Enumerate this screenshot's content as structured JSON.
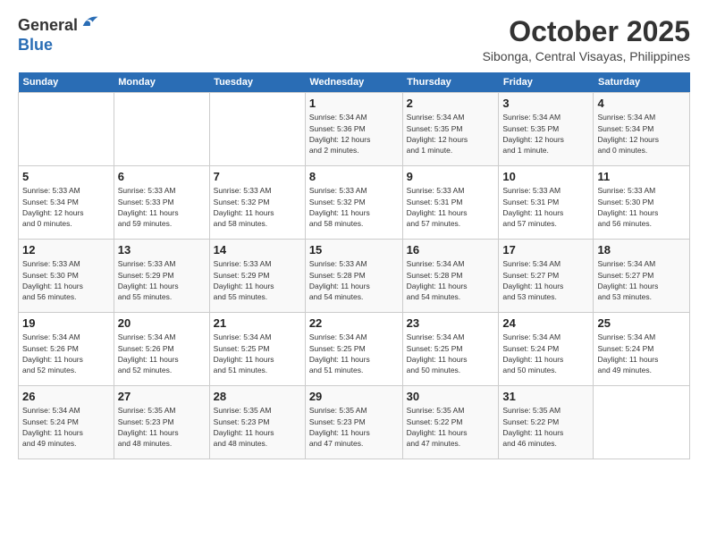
{
  "logo": {
    "general": "General",
    "blue": "Blue"
  },
  "header": {
    "month": "October 2025",
    "location": "Sibonga, Central Visayas, Philippines"
  },
  "days_of_week": [
    "Sunday",
    "Monday",
    "Tuesday",
    "Wednesday",
    "Thursday",
    "Friday",
    "Saturday"
  ],
  "weeks": [
    [
      {
        "day": "",
        "info": ""
      },
      {
        "day": "",
        "info": ""
      },
      {
        "day": "",
        "info": ""
      },
      {
        "day": "1",
        "info": "Sunrise: 5:34 AM\nSunset: 5:36 PM\nDaylight: 12 hours\nand 2 minutes."
      },
      {
        "day": "2",
        "info": "Sunrise: 5:34 AM\nSunset: 5:35 PM\nDaylight: 12 hours\nand 1 minute."
      },
      {
        "day": "3",
        "info": "Sunrise: 5:34 AM\nSunset: 5:35 PM\nDaylight: 12 hours\nand 1 minute."
      },
      {
        "day": "4",
        "info": "Sunrise: 5:34 AM\nSunset: 5:34 PM\nDaylight: 12 hours\nand 0 minutes."
      }
    ],
    [
      {
        "day": "5",
        "info": "Sunrise: 5:33 AM\nSunset: 5:34 PM\nDaylight: 12 hours\nand 0 minutes."
      },
      {
        "day": "6",
        "info": "Sunrise: 5:33 AM\nSunset: 5:33 PM\nDaylight: 11 hours\nand 59 minutes."
      },
      {
        "day": "7",
        "info": "Sunrise: 5:33 AM\nSunset: 5:32 PM\nDaylight: 11 hours\nand 58 minutes."
      },
      {
        "day": "8",
        "info": "Sunrise: 5:33 AM\nSunset: 5:32 PM\nDaylight: 11 hours\nand 58 minutes."
      },
      {
        "day": "9",
        "info": "Sunrise: 5:33 AM\nSunset: 5:31 PM\nDaylight: 11 hours\nand 57 minutes."
      },
      {
        "day": "10",
        "info": "Sunrise: 5:33 AM\nSunset: 5:31 PM\nDaylight: 11 hours\nand 57 minutes."
      },
      {
        "day": "11",
        "info": "Sunrise: 5:33 AM\nSunset: 5:30 PM\nDaylight: 11 hours\nand 56 minutes."
      }
    ],
    [
      {
        "day": "12",
        "info": "Sunrise: 5:33 AM\nSunset: 5:30 PM\nDaylight: 11 hours\nand 56 minutes."
      },
      {
        "day": "13",
        "info": "Sunrise: 5:33 AM\nSunset: 5:29 PM\nDaylight: 11 hours\nand 55 minutes."
      },
      {
        "day": "14",
        "info": "Sunrise: 5:33 AM\nSunset: 5:29 PM\nDaylight: 11 hours\nand 55 minutes."
      },
      {
        "day": "15",
        "info": "Sunrise: 5:33 AM\nSunset: 5:28 PM\nDaylight: 11 hours\nand 54 minutes."
      },
      {
        "day": "16",
        "info": "Sunrise: 5:34 AM\nSunset: 5:28 PM\nDaylight: 11 hours\nand 54 minutes."
      },
      {
        "day": "17",
        "info": "Sunrise: 5:34 AM\nSunset: 5:27 PM\nDaylight: 11 hours\nand 53 minutes."
      },
      {
        "day": "18",
        "info": "Sunrise: 5:34 AM\nSunset: 5:27 PM\nDaylight: 11 hours\nand 53 minutes."
      }
    ],
    [
      {
        "day": "19",
        "info": "Sunrise: 5:34 AM\nSunset: 5:26 PM\nDaylight: 11 hours\nand 52 minutes."
      },
      {
        "day": "20",
        "info": "Sunrise: 5:34 AM\nSunset: 5:26 PM\nDaylight: 11 hours\nand 52 minutes."
      },
      {
        "day": "21",
        "info": "Sunrise: 5:34 AM\nSunset: 5:25 PM\nDaylight: 11 hours\nand 51 minutes."
      },
      {
        "day": "22",
        "info": "Sunrise: 5:34 AM\nSunset: 5:25 PM\nDaylight: 11 hours\nand 51 minutes."
      },
      {
        "day": "23",
        "info": "Sunrise: 5:34 AM\nSunset: 5:25 PM\nDaylight: 11 hours\nand 50 minutes."
      },
      {
        "day": "24",
        "info": "Sunrise: 5:34 AM\nSunset: 5:24 PM\nDaylight: 11 hours\nand 50 minutes."
      },
      {
        "day": "25",
        "info": "Sunrise: 5:34 AM\nSunset: 5:24 PM\nDaylight: 11 hours\nand 49 minutes."
      }
    ],
    [
      {
        "day": "26",
        "info": "Sunrise: 5:34 AM\nSunset: 5:24 PM\nDaylight: 11 hours\nand 49 minutes."
      },
      {
        "day": "27",
        "info": "Sunrise: 5:35 AM\nSunset: 5:23 PM\nDaylight: 11 hours\nand 48 minutes."
      },
      {
        "day": "28",
        "info": "Sunrise: 5:35 AM\nSunset: 5:23 PM\nDaylight: 11 hours\nand 48 minutes."
      },
      {
        "day": "29",
        "info": "Sunrise: 5:35 AM\nSunset: 5:23 PM\nDaylight: 11 hours\nand 47 minutes."
      },
      {
        "day": "30",
        "info": "Sunrise: 5:35 AM\nSunset: 5:22 PM\nDaylight: 11 hours\nand 47 minutes."
      },
      {
        "day": "31",
        "info": "Sunrise: 5:35 AM\nSunset: 5:22 PM\nDaylight: 11 hours\nand 46 minutes."
      },
      {
        "day": "",
        "info": ""
      }
    ]
  ]
}
